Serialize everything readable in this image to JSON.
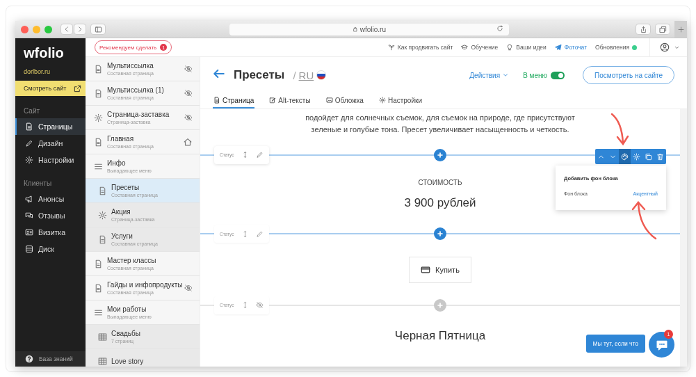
{
  "browser": {
    "url": "wfolio.ru"
  },
  "sidebar": {
    "logo": "wfolio",
    "domain": "dorlbor.ru",
    "view_site": "Смотреть сайт",
    "sections": [
      {
        "title": "Сайт",
        "items": [
          {
            "label": "Страницы",
            "selected": true
          },
          {
            "label": "Дизайн",
            "selected": false
          },
          {
            "label": "Настройки",
            "selected": false
          }
        ]
      },
      {
        "title": "Клиенты",
        "items": [
          {
            "label": "Анонсы",
            "selected": false
          },
          {
            "label": "Отзывы",
            "selected": false
          },
          {
            "label": "Визитка",
            "selected": false
          },
          {
            "label": "Диск",
            "selected": false
          }
        ]
      }
    ],
    "help": "База знаний"
  },
  "topbar": {
    "recommend": "Рекомендуем сделать",
    "recommend_count": "1",
    "links": [
      {
        "label": "Как продвигать сайт",
        "kind": "plain"
      },
      {
        "label": "Обучение",
        "kind": "plain"
      },
      {
        "label": "Ваши идеи",
        "kind": "plain"
      },
      {
        "label": "Фоточат",
        "kind": "accent"
      },
      {
        "label": "Обновления",
        "kind": "status"
      }
    ]
  },
  "pages": [
    {
      "title": "Мультиссылка",
      "subtitle": "Составная страница",
      "kind": "page",
      "hidden": true,
      "home": false,
      "selected": false
    },
    {
      "title": "Мультиссылка (1)",
      "subtitle": "Составная страница",
      "kind": "page",
      "hidden": true,
      "home": false,
      "selected": false
    },
    {
      "title": "Страница-заставка",
      "subtitle": "Страница-заставка",
      "kind": "splash",
      "hidden": true,
      "home": false,
      "selected": false
    },
    {
      "title": "Главная",
      "subtitle": "Составная страница",
      "kind": "page",
      "hidden": false,
      "home": true,
      "selected": false
    },
    {
      "title": "Инфо",
      "subtitle": "Выпадающее меню",
      "kind": "menu",
      "hidden": false,
      "home": false,
      "selected": false,
      "children": [
        {
          "title": "Пресеты",
          "subtitle": "Составная страница",
          "kind": "page",
          "hidden": false,
          "home": false,
          "selected": true
        },
        {
          "title": "Акция",
          "subtitle": "Страница-заставка",
          "kind": "splash",
          "hidden": false,
          "home": false,
          "selected": false
        },
        {
          "title": "Услуги",
          "subtitle": "Составная страница",
          "kind": "page",
          "hidden": false,
          "home": false,
          "selected": false
        }
      ]
    },
    {
      "title": "Мастер классы",
      "subtitle": "Составная страница",
      "kind": "page",
      "hidden": false,
      "home": false,
      "selected": false
    },
    {
      "title": "Гайды и инфопродукты",
      "subtitle": "Составная страница",
      "kind": "page",
      "hidden": true,
      "home": false,
      "selected": false
    },
    {
      "title": "Мои работы",
      "subtitle": "Выпадающее меню",
      "kind": "menu",
      "hidden": false,
      "home": false,
      "selected": false,
      "children": [
        {
          "title": "Свадьбы",
          "subtitle": "7 страниц",
          "kind": "gallery",
          "hidden": false,
          "home": false,
          "selected": false
        },
        {
          "title": "Love story",
          "kind": "gallery",
          "hidden": false,
          "home": false,
          "selected": false
        }
      ]
    }
  ],
  "header": {
    "title": "Пресеты",
    "slash": "/",
    "lang": "RU",
    "actions": "Действия",
    "in_menu": "В меню",
    "in_menu_on": true,
    "view_button": "Посмотреть на сайте"
  },
  "tabs": [
    {
      "label": "Страница",
      "selected": true
    },
    {
      "label": "Alt-тексты",
      "selected": false
    },
    {
      "label": "Обложка",
      "selected": false
    },
    {
      "label": "Настройки",
      "selected": false
    }
  ],
  "content": [
    {
      "kind": "paragraph",
      "lines": [
        "подойдет для солнечных съемок, для съемок на природе, где присутствуют",
        "зеленые и голубые тона. Пресет увеличивает насыщенность и четкость."
      ]
    },
    {
      "kind": "separator",
      "label": "Статус",
      "active": true,
      "hidden": false
    },
    {
      "kind": "price",
      "label": "СТОИМОСТЬ",
      "value": "3 900 рублей"
    },
    {
      "kind": "separator",
      "label": "Статус",
      "active": false,
      "hidden": false
    },
    {
      "kind": "button",
      "label": "Купить"
    },
    {
      "kind": "separator",
      "label": "Статус",
      "active": false,
      "hidden": true
    },
    {
      "kind": "heading",
      "text": "Черная Пятница"
    }
  ],
  "block_toolbar": {
    "buttons": [
      {
        "selected": false
      },
      {
        "selected": false
      },
      {
        "selected": true
      },
      {
        "selected": false
      },
      {
        "selected": false
      },
      {
        "selected": false
      }
    ]
  },
  "popover": {
    "title": "Добавить фон блока",
    "row_label": "Фон блока",
    "row_value": "Акцентный"
  },
  "chat": {
    "label": "Мы тут, если что",
    "badge": "1"
  }
}
